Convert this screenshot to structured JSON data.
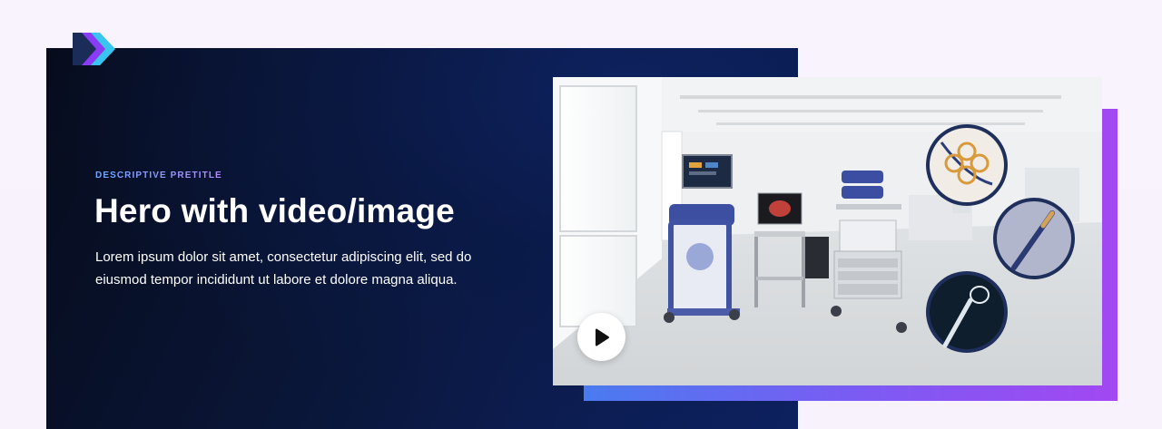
{
  "hero": {
    "pretitle": "DESCRIPTIVE PRETITLE",
    "title": "Hero with video/image",
    "body": "Lorem ipsum dolor sit amet, consectetur adipiscing elit, sed do eiusmod tempor incididunt ut labore et dolore magna aliqua."
  },
  "media": {
    "play_icon": "play-icon",
    "logo_icon": "chevron-arrows-logo"
  },
  "colors": {
    "panel_dark": "#0a1638",
    "accent_start": "#4a7bf0",
    "accent_end": "#a248f2",
    "logo_dark": "#1b2c58",
    "logo_purple": "#8b3bf5",
    "logo_cyan": "#38c5f0"
  }
}
